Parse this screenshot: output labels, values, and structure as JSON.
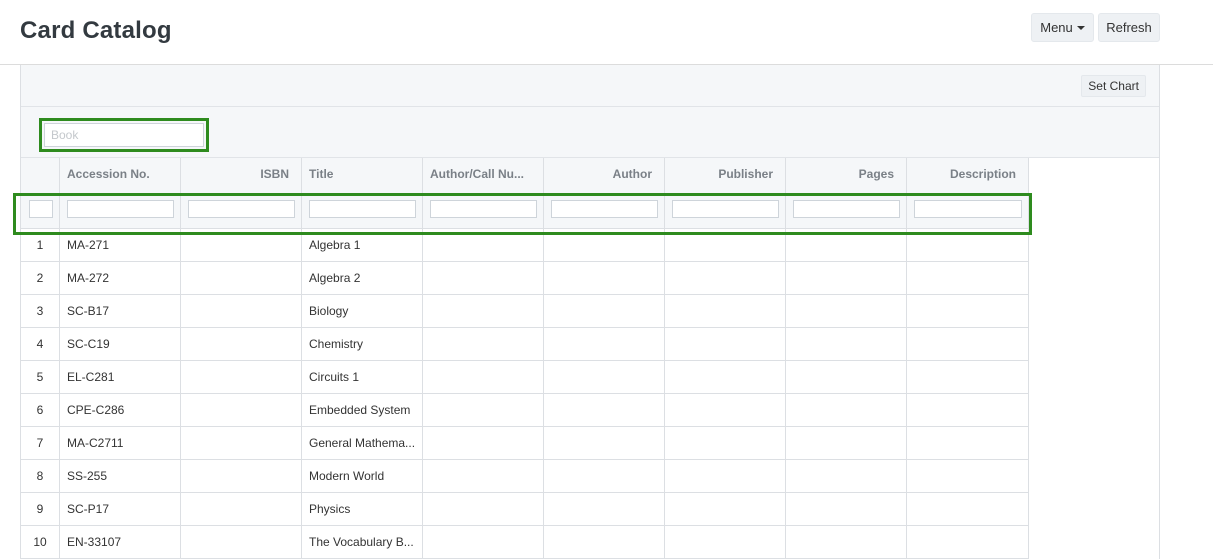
{
  "page": {
    "title": "Card Catalog"
  },
  "toolbar": {
    "menu_label": "Menu",
    "refresh_label": "Refresh",
    "set_chart_label": "Set Chart"
  },
  "search": {
    "placeholder": "Book",
    "value": ""
  },
  "grid": {
    "columns": [
      {
        "key": "row",
        "label": ""
      },
      {
        "key": "accession",
        "label": "Accession No."
      },
      {
        "key": "isbn",
        "label": "ISBN"
      },
      {
        "key": "title",
        "label": "Title"
      },
      {
        "key": "author_call",
        "label": "Author/Call Nu..."
      },
      {
        "key": "author",
        "label": "Author"
      },
      {
        "key": "publisher",
        "label": "Publisher"
      },
      {
        "key": "pages",
        "label": "Pages"
      },
      {
        "key": "description",
        "label": "Description"
      }
    ],
    "rows": [
      {
        "row": "1",
        "accession": "MA-271",
        "isbn": "",
        "title": "Algebra 1",
        "author_call": "",
        "author": "",
        "publisher": "",
        "pages": "",
        "description": ""
      },
      {
        "row": "2",
        "accession": "MA-272",
        "isbn": "",
        "title": "Algebra 2",
        "author_call": "",
        "author": "",
        "publisher": "",
        "pages": "",
        "description": ""
      },
      {
        "row": "3",
        "accession": "SC-B17",
        "isbn": "",
        "title": "Biology",
        "author_call": "",
        "author": "",
        "publisher": "",
        "pages": "",
        "description": ""
      },
      {
        "row": "4",
        "accession": "SC-C19",
        "isbn": "",
        "title": "Chemistry",
        "author_call": "",
        "author": "",
        "publisher": "",
        "pages": "",
        "description": ""
      },
      {
        "row": "5",
        "accession": "EL-C281",
        "isbn": "",
        "title": "Circuits 1",
        "author_call": "",
        "author": "",
        "publisher": "",
        "pages": "",
        "description": ""
      },
      {
        "row": "6",
        "accession": "CPE-C286",
        "isbn": "",
        "title": "Embedded System",
        "author_call": "",
        "author": "",
        "publisher": "",
        "pages": "",
        "description": ""
      },
      {
        "row": "7",
        "accession": "MA-C2711",
        "isbn": "",
        "title": "General Mathema...",
        "author_call": "",
        "author": "",
        "publisher": "",
        "pages": "",
        "description": ""
      },
      {
        "row": "8",
        "accession": "SS-255",
        "isbn": "",
        "title": "Modern World",
        "author_call": "",
        "author": "",
        "publisher": "",
        "pages": "",
        "description": ""
      },
      {
        "row": "9",
        "accession": "SC-P17",
        "isbn": "",
        "title": "Physics",
        "author_call": "",
        "author": "",
        "publisher": "",
        "pages": "",
        "description": ""
      },
      {
        "row": "10",
        "accession": "EN-33107",
        "isbn": "",
        "title": "The Vocabulary B...",
        "author_call": "",
        "author": "",
        "publisher": "",
        "pages": "",
        "description": ""
      }
    ]
  },
  "icons": {
    "menu_caret": "caret-down-icon"
  },
  "colors": {
    "highlight": "#2e8b1e",
    "header_bg": "#f5f7f9",
    "header_text": "#7a8087"
  }
}
